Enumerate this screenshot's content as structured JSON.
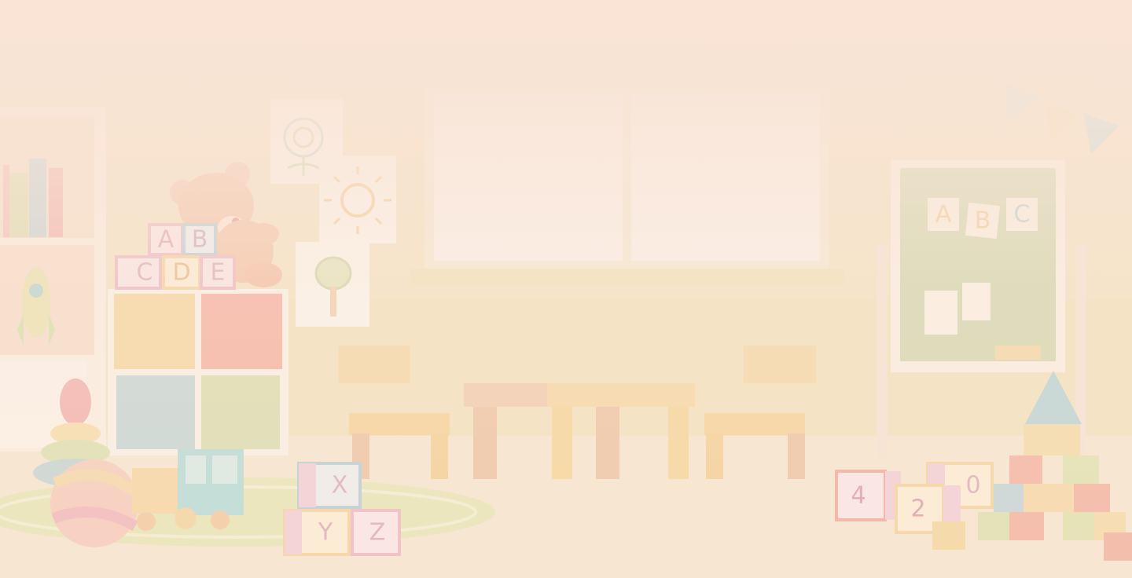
{
  "scene": {
    "description_free": true
  },
  "blocks": {
    "shelf_top_row": [
      "A",
      "B"
    ],
    "shelf_bottom_row": [
      "C",
      "D",
      "E"
    ],
    "floor_top": [
      "X"
    ],
    "floor_bottom": [
      "Y",
      "Z"
    ],
    "right_top": [
      "0"
    ],
    "right_bottom": [
      "4",
      "2"
    ]
  },
  "chalkboard": {
    "letters": [
      "A",
      "B",
      "C"
    ]
  },
  "colors": {
    "wall": "#f4e6c9",
    "floor": "#f5ead2",
    "window": "#f7efe6",
    "chalkboard": "#c9d6a7",
    "overlay": "#f6e3d1"
  },
  "icons": [
    "flower-drawing",
    "sun-drawing",
    "tree-drawing",
    "teddy-bear",
    "rocket-toy",
    "ball",
    "ring-stacker",
    "toy-truck",
    "bunting-flags"
  ]
}
